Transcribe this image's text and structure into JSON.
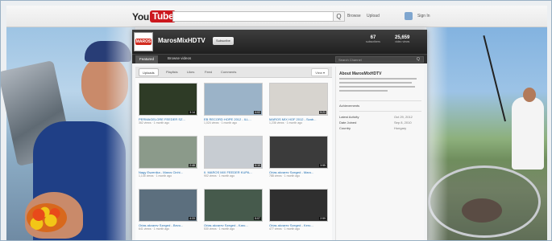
{
  "youtube": {
    "logo_you": "You",
    "logo_tube": "Tube",
    "search_button": "Q",
    "browse": "Browse",
    "upload": "Upload",
    "sign_in": "Sign In"
  },
  "channel": {
    "avatar_mark": "MAROS",
    "name": "MarosMixHDTV",
    "subscribe": "Subscribe",
    "stats": [
      {
        "num": "67",
        "label": "subscribers"
      },
      {
        "num": "25,659",
        "label": "video views"
      }
    ],
    "nav": {
      "tabs": [
        "Featured",
        "Browse videos"
      ],
      "search_placeholder": "Search Channel",
      "search_icon": "Q"
    },
    "filters": [
      "Uploads",
      "Playlists",
      "Likes",
      "Feed",
      "Comments"
    ],
    "view_button": "View ▾",
    "videos": [
      {
        "title": "PERMAGELORE FEEDER SZ...",
        "meta": "362 views · 1 month ago",
        "duration": "3:14",
        "thumb": "#2e3b26"
      },
      {
        "title": "EB RECORD HOPE 2012 - ILL...",
        "meta": "1,024 views · 1 month ago",
        "duration": "4:02",
        "thumb": "#9bb3c8"
      },
      {
        "title": "MAROS MIX HOF 2012 - Szab...",
        "meta": "1,236 views · 1 month ago",
        "duration": "5:21",
        "thumb": "#d7d4cf"
      },
      {
        "title": "Nagy Eszenika - Maros Cinhi...",
        "meta": "1,145 views · 1 month ago",
        "duration": "2:48",
        "thumb": "#8b9a8a"
      },
      {
        "title": "II. MAROS MIX FEEDER KUPA...",
        "meta": "902 views · 1 month ago",
        "duration": "6:10",
        "thumb": "#c7ccd2"
      },
      {
        "title": "Orias akvarev Szeged - Maro...",
        "meta": "788 views · 1 month ago",
        "duration": "3:55",
        "thumb": "#3b3b3b"
      },
      {
        "title": "Orias akvarev Szeged - Bevo...",
        "meta": "641 views · 1 month ago",
        "duration": "4:33",
        "thumb": "#5c6f7e"
      },
      {
        "title": "Orias akvarev Szeged - Karo...",
        "meta": "530 views · 1 month ago",
        "duration": "5:07",
        "thumb": "#465a4c"
      },
      {
        "title": "Orias akvarev Szeged - Kero...",
        "meta": "477 views · 1 month ago",
        "duration": "2:59",
        "thumb": "#2f2f2f"
      }
    ],
    "sidebar": {
      "title": "About MarosMixHDTV",
      "achievements_label": "Achievements",
      "rows": [
        {
          "label": "Latest Activity",
          "value": "Oct 29, 2012"
        },
        {
          "label": "Date Joined",
          "value": "Sep 8, 2010"
        },
        {
          "label": "Country",
          "value": "Hungary"
        }
      ]
    }
  }
}
